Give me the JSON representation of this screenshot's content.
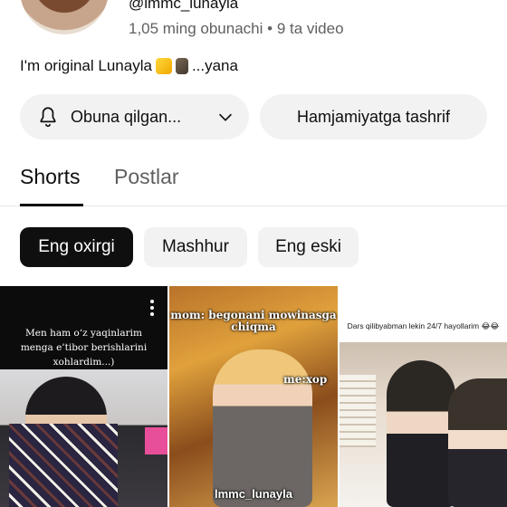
{
  "channel": {
    "handle": "@lmmc_lunayla",
    "subscribers": "1,05 ming obunachi",
    "separator": "•",
    "video_count": "9 ta video",
    "description_text": "I'm original Lunayla",
    "description_more": "...yana"
  },
  "actions": {
    "subscribe_label": "Obuna qilgan...",
    "community_label": "Hamjamiyatga tashrif"
  },
  "tabs": [
    {
      "label": "Shorts",
      "active": true
    },
    {
      "label": "Postlar",
      "active": false
    }
  ],
  "filters": [
    {
      "label": "Eng oxirgi",
      "active": true
    },
    {
      "label": "Mashhur",
      "active": false
    },
    {
      "label": "Eng eski",
      "active": false
    }
  ],
  "shorts": [
    {
      "caption": "Men ham o‘z yaqinlarim menga e’tibor berishlarini xohlardim...)"
    },
    {
      "caption": "mom: begonani mowinasga chiqma",
      "overlay": "me:xop",
      "watermark": "lmmc_lunayla"
    },
    {
      "caption": "Dars qilibyabman lekin 24/7 hayollarim 😂😂"
    }
  ],
  "icons": {
    "bell": "bell-icon",
    "chevron": "chevron-down-icon",
    "more": "more-vert-icon"
  },
  "colors": {
    "chip_active_bg": "#0f0f0f",
    "chip_bg": "#f2f2f2",
    "secondary_text": "#606060"
  }
}
